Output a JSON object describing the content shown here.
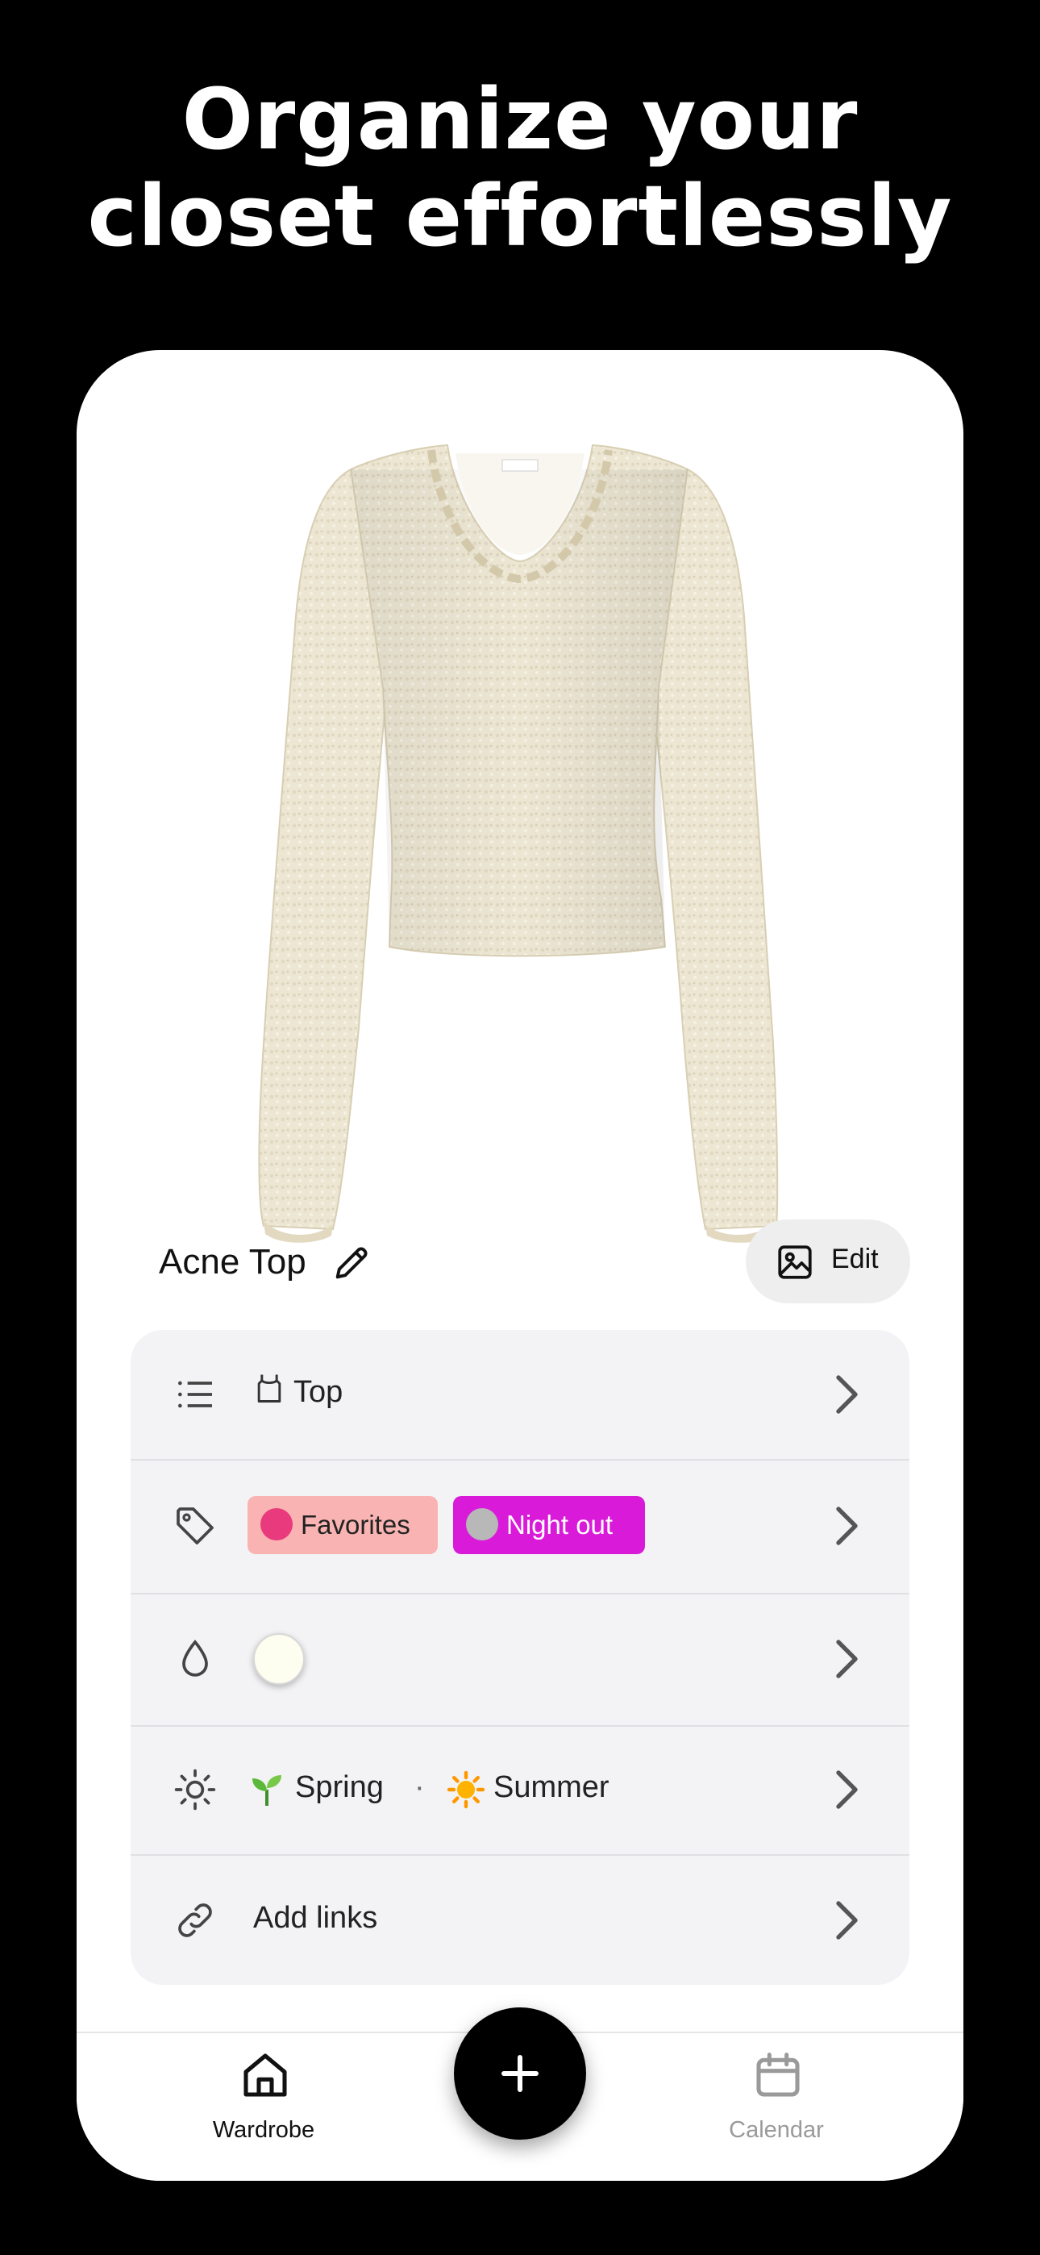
{
  "headline": {
    "line1": "Organize your",
    "line2": "closet effortlessly"
  },
  "item": {
    "title": "Acne Top",
    "edit_label": "Edit"
  },
  "details": {
    "category": {
      "label": "Top",
      "icon": "list-icon",
      "category_icon": "top-icon"
    },
    "tags": {
      "icon": "tag-icon",
      "items": [
        {
          "label": "Favorites",
          "background": "#f9b3b3",
          "text_color": "#222222",
          "emoji": "heart-emoji"
        },
        {
          "label": "Night out",
          "background": "#d91bd9",
          "text_color": "#ffffff",
          "emoji": "disco-ball-emoji"
        }
      ]
    },
    "color": {
      "icon": "droplet-icon",
      "swatch": "#fdfdf0"
    },
    "seasons": {
      "icon": "sun-icon",
      "items": [
        {
          "label": "Spring",
          "emoji": "seedling-emoji"
        },
        {
          "label": "Summer",
          "emoji": "sun-emoji"
        }
      ],
      "separator": "·"
    },
    "links": {
      "label": "Add links",
      "icon": "link-icon"
    }
  },
  "tabbar": {
    "wardrobe": {
      "label": "Wardrobe",
      "active": true,
      "color": "#111111"
    },
    "calendar": {
      "label": "Calendar",
      "active": false,
      "color": "#9a9a9a"
    },
    "add_icon": "plus-icon"
  },
  "colors": {
    "background": "#000000",
    "card": "#ffffff",
    "panel": "#f3f3f5"
  }
}
